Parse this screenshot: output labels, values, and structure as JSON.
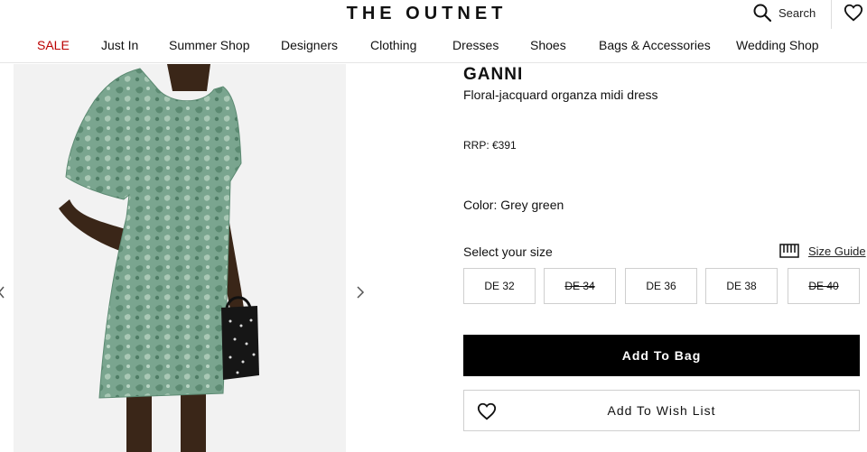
{
  "header": {
    "logo": "THE OUTNET",
    "search_label": "Search"
  },
  "nav": {
    "items": [
      "SALE",
      "Just In",
      "Summer Shop",
      "Designers",
      "Clothing",
      "Dresses",
      "Shoes",
      "Bags & Accessories",
      "Wedding Shop"
    ]
  },
  "product": {
    "brand": "GANNI",
    "name": "Floral-jacquard organza midi dress",
    "rrp": "RRP:  €391",
    "color": "Color: Grey green",
    "size_label": "Select your size",
    "size_guide": "Size Guide",
    "sizes": [
      {
        "label": "DE 32",
        "available": true
      },
      {
        "label": "DE 34",
        "available": false
      },
      {
        "label": "DE 36",
        "available": true
      },
      {
        "label": "DE 38",
        "available": true
      },
      {
        "label": "DE 40",
        "available": false
      }
    ],
    "add_to_bag": "Add To Bag",
    "add_to_wishlist": "Add To Wish List"
  },
  "colors": {
    "sale": "#b00000",
    "dress": "#6f9a84",
    "button": "#000000"
  }
}
